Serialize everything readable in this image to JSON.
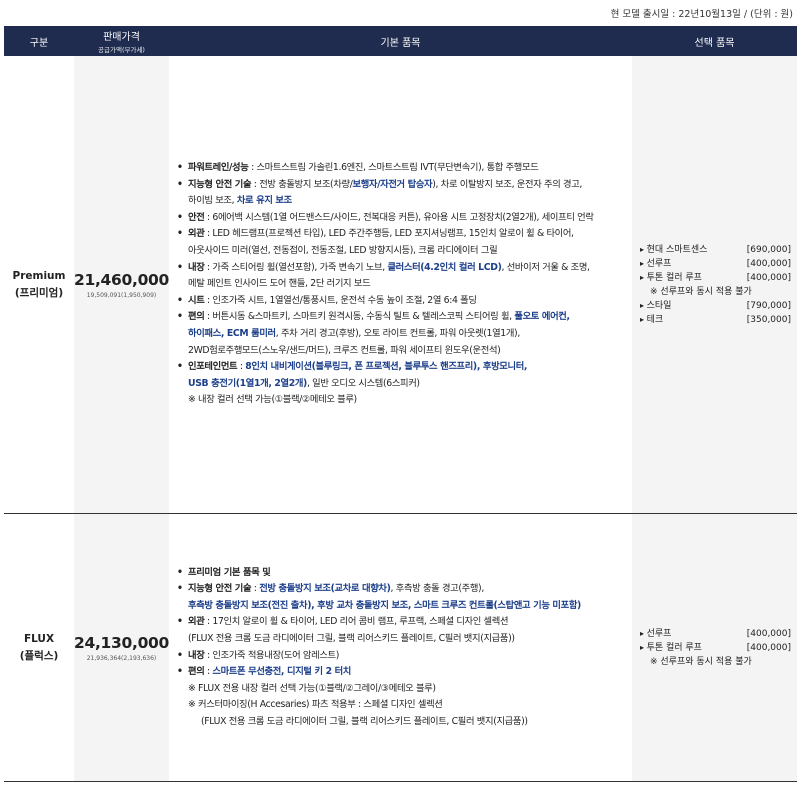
{
  "release_note": "현 모델 출시일 : 22년10월13일 / (단위 : 원)",
  "header": {
    "col_category": "구분",
    "col_price": "판매가격",
    "col_price_sub": "공급가액(부가세)",
    "col_basic": "기본 품목",
    "col_option": "선택 품목"
  },
  "premium": {
    "name_en": "Premium",
    "name_ko": "(프리미엄)",
    "price": "21,460,000",
    "price_sub": "19,509,091(1,950,909)",
    "b1_key": "파워트레인/성능",
    "b1_text": " : 스마트스트림 가솔린1.6엔진, 스마트스트림 IVT(무단변속기), 통합 주행모드",
    "b2_key": "지능형 안전 기술",
    "b2_a": " : 전방 충돌방지 보조(차량/",
    "b2_hl": "보행자/자전거 탑승자",
    "b2_b": "), 차로 이탈방지 보조, 운전자 주의 경고,",
    "b2_c": "하이빔 보조, ",
    "b2_hl2": "차로 유지 보조",
    "b3_key": "안전",
    "b3_text": " : 6에어백 시스템(1열 어드밴스드/사이드, 전복대응 커튼), 유아용 시트 고정장치(2열2개), 세이프티 언락",
    "b4_key": "외관",
    "b4_a": " : LED 헤드램프(프로젝션 타입), LED 주간주행등, LED 포지셔닝램프, 15인치 알로이 휠 & 타이어,",
    "b4_b": "아웃사이드 미러(열선, 전동접이, 전동조절, LED 방향지시등), 크롬 라디에이터 그릴",
    "b5_key": "내장",
    "b5_a": " : 가죽 스티어링 휠(열선포함), 가죽 변속기 노브, ",
    "b5_hl": "클러스터(4.2인치 컬러 LCD)",
    "b5_b": ", 선바이저 거울 & 조명,",
    "b5_c": "메탈 페인트 인사이드 도어 핸들, 2단 러기지 보드",
    "b6_key": "시트",
    "b6_text": " : 인조가죽 시트, 1열열선/통풍시트, 운전석 수동 높이 조절, 2열 6:4 폴딩",
    "b7_key": "편의",
    "b7_a": " : 버튼시동 &스마트키, 스마트키 원격시동, 수동식 틸트 & 텔레스코픽 스티어링 휠, ",
    "b7_hl": "풀오토 에어컨,",
    "b7_hl2": "하이패스, ECM 룸미러",
    "b7_b": ", 주차 거리 경고(후방), 오토 라이트 컨트롤, 파워 아웃렛(1열1개),",
    "b7_c": "2WD험로주행모드(스노우/샌드/머드), 크루즈 컨트롤, 파워 세이프티 윈도우(운전석)",
    "b8_key": "인포테인먼트",
    "b8_a": " : ",
    "b8_hl": "8인치 내비게이션(블루링크, 폰 프로젝션, 블루투스 핸즈프리), 후방모니터,",
    "b8_hl2": "USB 충전기(1열1개, 2열2개)",
    "b8_b": ", 일반 오디오 시스템(6스피커)",
    "b_note": "※ 내장 컬러 선택 가능(①블랙/②메테오 블루)",
    "options": [
      {
        "name": "현대 스마트센스",
        "price": "[690,000]"
      },
      {
        "name": "선루프",
        "price": "[400,000]"
      },
      {
        "name": "투톤 컬러 루프",
        "price": "[400,000]"
      }
    ],
    "option_note": "※ 선루프와 동시 적용 불가",
    "options2": [
      {
        "name": "스타일",
        "price": "[790,000]"
      },
      {
        "name": "테크",
        "price": "[350,000]"
      }
    ]
  },
  "flux": {
    "name_en": "FLUX",
    "name_ko": "(플럭스)",
    "price": "24,130,000",
    "price_sub": "21,936,364(2,193,636)",
    "f1_text": "프리미엄 기본 품목 및",
    "f2_key": "지능형 안전 기술",
    "f2_a": " : ",
    "f2_hl": "전방 충돌방지 보조(교차로 대향차)",
    "f2_b": ", 후측방 충돌 경고(주행),",
    "f2_hl2": "후측방 충돌방지 보조(전진 출차), 후방 교차 충돌방지 보조, 스마트 크루즈 컨트롤(스탑앤고 기능 미포함)",
    "f3_key": "외관",
    "f3_a": " : 17인치 알로이 휠 & 타이어, LED 리어 콤비 램프, 루프랙, 스페셜 디자인 셀렉션",
    "f3_b": "(FLUX 전용 크롬 도금 라디에이터 그릴, 블랙 리어스키드 플레이트, C필러 뱃지(지급품))",
    "f4_key": "내장",
    "f4_text": " : 인조가죽 적용내장(도어 암레스트)",
    "f5_key": "편의",
    "f5_a": " : ",
    "f5_hl": "스마트폰 무선충전, 디지털 키 2 터치",
    "f_note1": "※ FLUX 전용 내장 컬러 선택 가능(①블랙/②그레이/③메테오 블루)",
    "f_note2": "※ 커스터마이징(H Accesaries) 파츠 적용부 : 스페셜 디자인 셀렉션",
    "f_note3": "(FLUX 전용 크롬 도금 라디에이터 그릴, 블랙 리어스키드 플레이트, C필러 뱃지(지급품))",
    "options": [
      {
        "name": "선루프",
        "price": "[400,000]"
      },
      {
        "name": "투톤 컬러 루프",
        "price": "[400,000]"
      }
    ],
    "option_note": "※ 선루프와 동시 적용 불가"
  }
}
